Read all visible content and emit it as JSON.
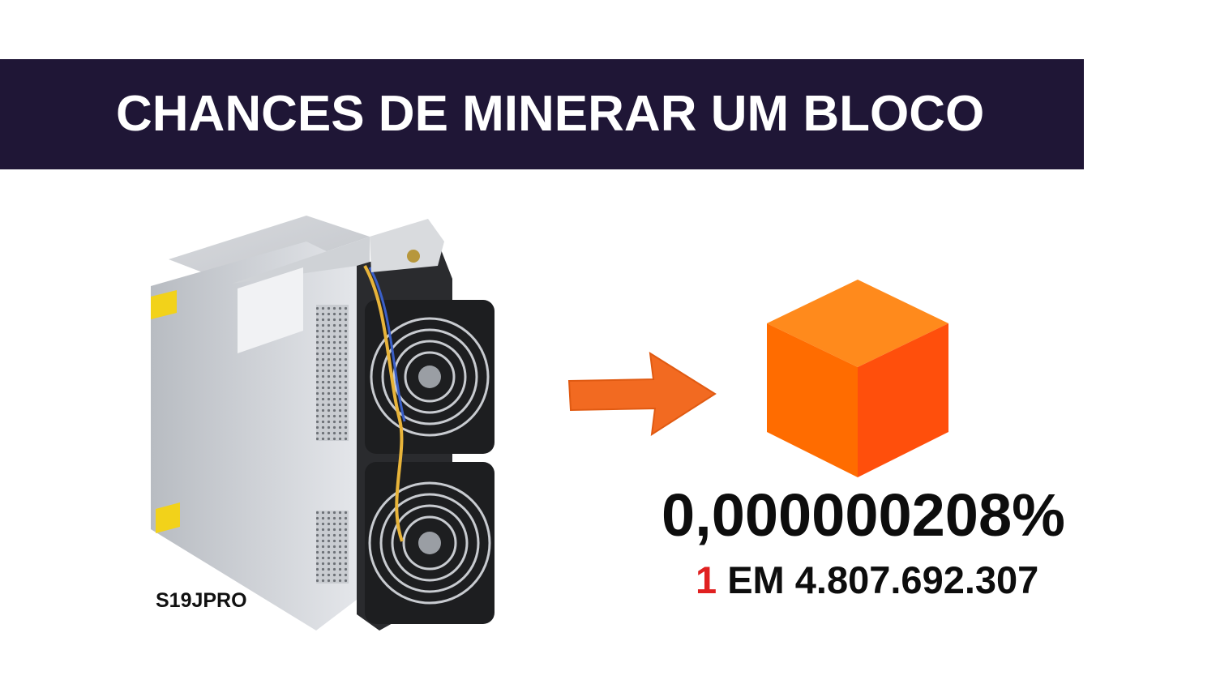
{
  "banner": {
    "title": "CHANCES DE MINERAR UM BLOCO",
    "bg_color": "#1f1636"
  },
  "miner": {
    "label": "S19JPRO",
    "icon": "asic-miner-image"
  },
  "arrow": {
    "icon": "arrow-right-icon",
    "color": "#f26a21"
  },
  "block": {
    "icon": "orange-cube-icon",
    "colors": [
      "#ff8a1c",
      "#ff6a00",
      "#ff4a10"
    ]
  },
  "probability": {
    "percent": "0,000000208%",
    "odds_one": "1",
    "odds_rest": " EM 4.807.692.307",
    "highlight_color": "#e02020"
  }
}
